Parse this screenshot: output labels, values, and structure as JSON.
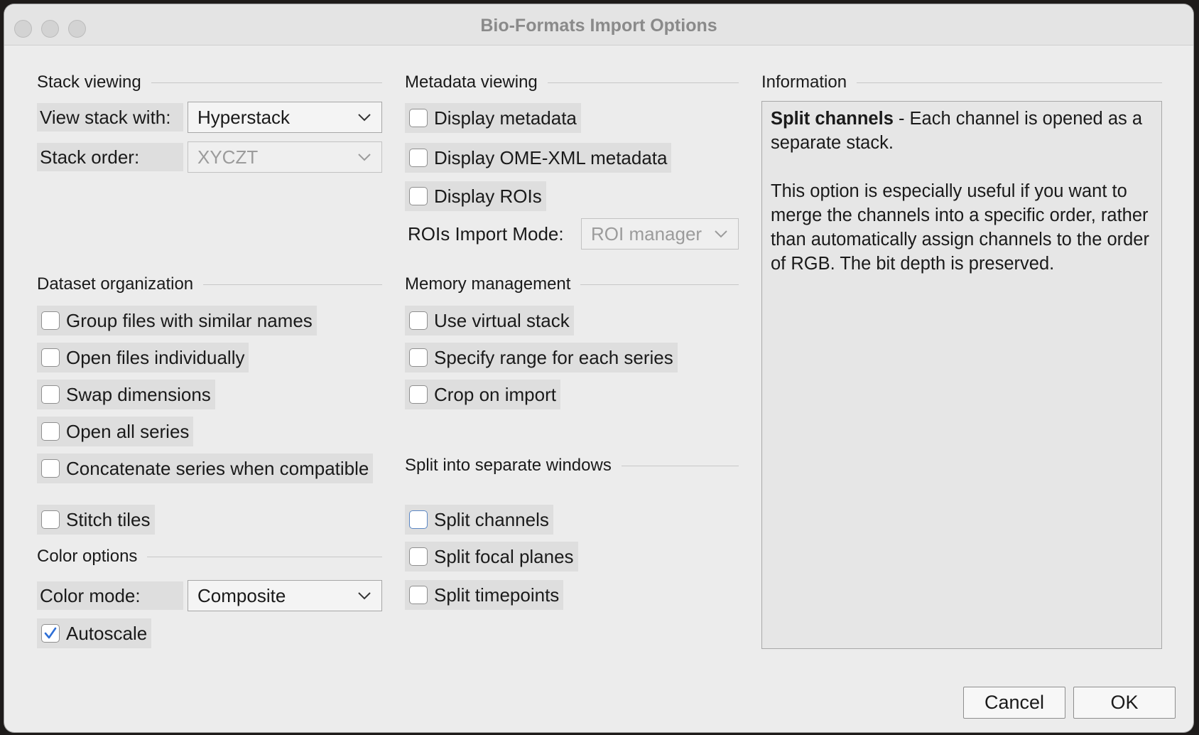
{
  "window": {
    "title": "Bio-Formats Import Options"
  },
  "sections": {
    "stack_viewing": "Stack viewing",
    "metadata_viewing": "Metadata viewing",
    "information": "Information",
    "dataset_organization": "Dataset organization",
    "memory_management": "Memory management",
    "split_windows": "Split into separate windows",
    "color_options": "Color options"
  },
  "stack_viewing": {
    "view_stack_label": "View stack with:",
    "view_stack_value": "Hyperstack",
    "stack_order_label": "Stack order:",
    "stack_order_value": "XYCZT"
  },
  "metadata_viewing": {
    "display_metadata": {
      "label": "Display metadata",
      "checked": false
    },
    "display_ome_xml": {
      "label": "Display OME-XML metadata",
      "checked": false
    },
    "display_rois": {
      "label": "Display ROIs",
      "checked": false
    },
    "rois_import_mode_label": "ROIs Import Mode:",
    "rois_import_mode_value": "ROI manager"
  },
  "dataset_organization": {
    "group_files": {
      "label": "Group files with similar names",
      "checked": false
    },
    "open_individually": {
      "label": "Open files individually",
      "checked": false
    },
    "swap_dimensions": {
      "label": "Swap dimensions",
      "checked": false
    },
    "open_all_series": {
      "label": "Open all series",
      "checked": false
    },
    "concatenate": {
      "label": "Concatenate series when compatible",
      "checked": false
    },
    "stitch_tiles": {
      "label": "Stitch tiles",
      "checked": false
    }
  },
  "memory_management": {
    "virtual_stack": {
      "label": "Use virtual stack",
      "checked": false
    },
    "specify_range": {
      "label": "Specify range for each series",
      "checked": false
    },
    "crop_on_import": {
      "label": "Crop on import",
      "checked": false
    }
  },
  "split_windows": {
    "split_channels": {
      "label": "Split channels",
      "checked": false
    },
    "split_focal_planes": {
      "label": "Split focal planes",
      "checked": false
    },
    "split_timepoints": {
      "label": "Split timepoints",
      "checked": false
    }
  },
  "color_options": {
    "color_mode_label": "Color mode:",
    "color_mode_value": "Composite",
    "autoscale": {
      "label": "Autoscale",
      "checked": true
    }
  },
  "information": {
    "heading": "Split channels",
    "lead": " - Each channel is opened as a separate stack.",
    "body": "This option is especially useful if you want to merge the channels into a specific order, rather than automatically assign channels to the order of RGB. The bit depth is preserved."
  },
  "buttons": {
    "cancel": "Cancel",
    "ok": "OK"
  },
  "colors": {
    "checkbox_accent": "#2e6fd6",
    "focus_border": "#5b87c4"
  }
}
